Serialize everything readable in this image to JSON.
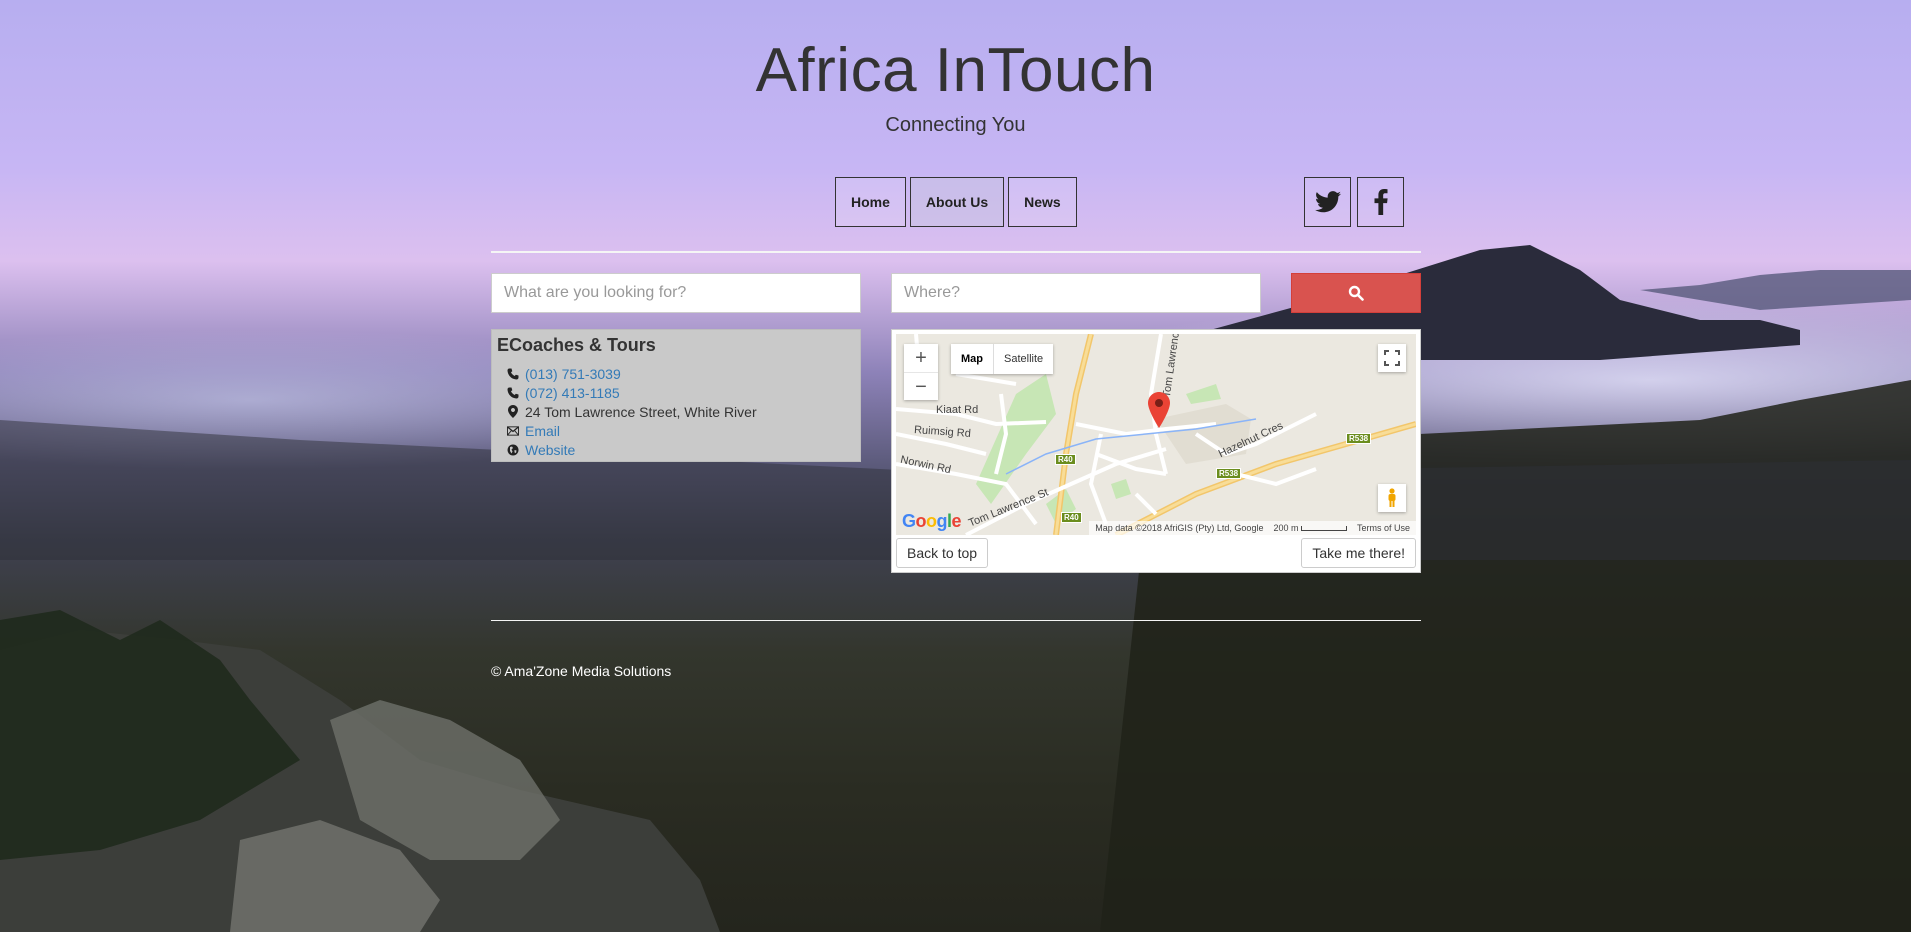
{
  "header": {
    "title": "Africa InTouch",
    "tagline": "Connecting You"
  },
  "nav": {
    "home": "Home",
    "about": "About Us",
    "news": "News"
  },
  "social": {
    "twitter_icon": "twitter-icon",
    "facebook_icon": "facebook-icon"
  },
  "search": {
    "what_placeholder": "What are you looking for?",
    "where_placeholder": "Where?",
    "button_icon": "search-icon",
    "button_color": "#d9534f"
  },
  "listing": {
    "name": "ECoaches & Tours",
    "phone1": "(013) 751-3039",
    "phone2": "(072) 413-1185",
    "address": "24 Tom Lawrence Street, White River",
    "email_label": "Email",
    "website_label": "Website"
  },
  "map": {
    "type_map": "Map",
    "type_satellite": "Satellite",
    "zoom_in": "+",
    "zoom_out": "−",
    "attribution": "Map data ©2018 AfriGIS (Pty) Ltd, Google",
    "scale": "200 m",
    "terms": "Terms of Use",
    "roads": {
      "kiaat": "Kiaat Rd",
      "ruimsig": "Ruimsig Rd",
      "norwin": "Norwin Rd",
      "tom_lawrence_st": "Tom Lawrence St",
      "tom_lawrence": "Tom Lawrence",
      "hazelnut": "Hazelnut Cres",
      "r40a": "R40",
      "r40b": "R40",
      "r538a": "R538",
      "r538b": "R538"
    },
    "back_to_top": "Back to top",
    "take_me_there": "Take me there!"
  },
  "footer": {
    "copyright": "© Ama'Zone Media Solutions"
  }
}
